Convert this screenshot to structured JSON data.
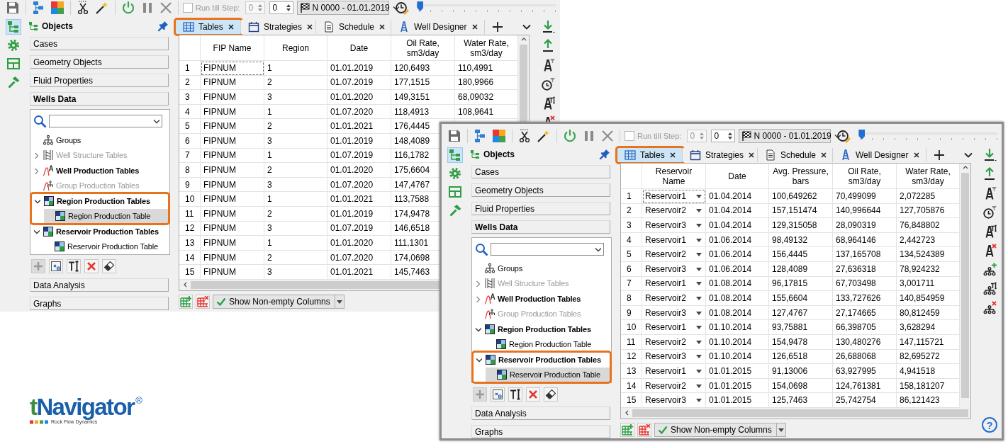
{
  "windows": [
    {
      "framed": false,
      "toolbar": {
        "run_till_step": {
          "label": "Run till Step:",
          "checked": false,
          "value": "0"
        },
        "step": "0",
        "time_step": "N 0000 - 01.01.2019",
        "slider": {
          "level": 0
        }
      },
      "side_tabs": [
        {
          "selected": true
        },
        {
          "selected": false
        },
        {
          "selected": false
        },
        {
          "selected": false
        }
      ],
      "objects_panel": {
        "title": "Objects",
        "sections": [
          {
            "label": "Cases",
            "expanded": false
          },
          {
            "label": "Geometry Objects",
            "expanded": false
          },
          {
            "label": "Fluid Properties",
            "expanded": false
          },
          {
            "label": "Wells Data",
            "expanded": true
          },
          {
            "label": "Data Analysis",
            "expanded": false
          },
          {
            "label": "Graphs",
            "expanded": false
          }
        ],
        "tree": [
          {
            "label": "Groups",
            "kind": "groups",
            "disabled": false,
            "selected": false,
            "highlighted": false
          },
          {
            "label": "Well Structure Tables",
            "kind": "well-structure",
            "expanded": false,
            "disabled": true,
            "selected": false,
            "highlighted": false
          },
          {
            "label": "Well Production Tables",
            "kind": "well-production",
            "expanded": false,
            "disabled": false,
            "selected": false,
            "highlighted": false
          },
          {
            "label": "Group Production Tables",
            "kind": "group-production",
            "disabled": true,
            "selected": false,
            "highlighted": false
          },
          {
            "label": "Region Production Tables",
            "kind": "table",
            "expanded": true,
            "disabled": false,
            "selected": false,
            "highlighted": true,
            "children": [
              {
                "label": "Region Production Table",
                "kind": "table",
                "disabled": false,
                "selected": true,
                "highlighted": false
              }
            ]
          },
          {
            "label": "Reservoir Production Tables",
            "kind": "table",
            "expanded": true,
            "disabled": false,
            "selected": false,
            "highlighted": false,
            "children": [
              {
                "label": "Reservoir Production Table",
                "kind": "table",
                "disabled": false,
                "selected": false,
                "highlighted": false
              }
            ]
          }
        ],
        "tree_tools": [
          {
            "kind": "add",
            "disabled": true
          },
          {
            "kind": "duplicate",
            "disabled": false
          },
          {
            "kind": "rename",
            "disabled": false
          },
          {
            "kind": "delete",
            "disabled": false
          },
          {
            "kind": "clear",
            "disabled": false
          }
        ]
      },
      "tabs": [
        {
          "label": "Tables",
          "kind": "table",
          "selected": true,
          "highlighted": true
        },
        {
          "label": "Strategies",
          "kind": "calendar",
          "selected": false,
          "highlighted": false
        },
        {
          "label": "Schedule",
          "kind": "document",
          "selected": false,
          "highlighted": false
        },
        {
          "label": "Well Designer",
          "kind": "well",
          "selected": false,
          "highlighted": false
        }
      ],
      "table": {
        "columns": [
          {
            "label": "FIP Name",
            "kind": "text"
          },
          {
            "label": "Region",
            "kind": "text"
          },
          {
            "label": "Date",
            "kind": "text"
          },
          {
            "label": "Oil Rate, sm3/day",
            "kind": "text"
          },
          {
            "label": "Water Rate, sm3/day",
            "kind": "text"
          }
        ],
        "rows": [
          {
            "number": "1",
            "focused": true,
            "cells": [
              "FIPNUM",
              "1",
              "01.01.2019",
              "120,6493",
              "110,4991"
            ]
          },
          {
            "number": "2",
            "focused": false,
            "cells": [
              "FIPNUM",
              "2",
              "01.07.2019",
              "177,1515",
              "180,9966"
            ]
          },
          {
            "number": "3",
            "focused": false,
            "cells": [
              "FIPNUM",
              "3",
              "01.01.2020",
              "149,3151",
              "68,09032"
            ]
          },
          {
            "number": "4",
            "focused": false,
            "cells": [
              "FIPNUM",
              "1",
              "01.07.2020",
              "118,4913",
              "108,9641"
            ]
          },
          {
            "number": "5",
            "focused": false,
            "cells": [
              "FIPNUM",
              "2",
              "01.01.2021",
              "176,4445"
            ]
          },
          {
            "number": "6",
            "focused": false,
            "cells": [
              "FIPNUM",
              "3",
              "01.01.2019",
              "148,4089"
            ]
          },
          {
            "number": "7",
            "focused": false,
            "cells": [
              "FIPNUM",
              "1",
              "01.07.2019",
              "116,1782"
            ]
          },
          {
            "number": "8",
            "focused": false,
            "cells": [
              "FIPNUM",
              "2",
              "01.01.2020",
              "175,6604"
            ]
          },
          {
            "number": "9",
            "focused": false,
            "cells": [
              "FIPNUM",
              "3",
              "01.07.2020",
              "147,4767"
            ]
          },
          {
            "number": "10",
            "focused": false,
            "cells": [
              "FIPNUM",
              "1",
              "01.01.2021",
              "113,7588"
            ]
          },
          {
            "number": "11",
            "focused": false,
            "cells": [
              "FIPNUM",
              "2",
              "01.01.2019",
              "174,9478"
            ]
          },
          {
            "number": "12",
            "focused": false,
            "cells": [
              "FIPNUM",
              "3",
              "01.07.2019",
              "146,6518"
            ]
          },
          {
            "number": "13",
            "focused": false,
            "cells": [
              "FIPNUM",
              "1",
              "01.01.2020",
              "111,1301"
            ]
          },
          {
            "number": "14",
            "focused": false,
            "cells": [
              "FIPNUM",
              "2",
              "01.07.2020",
              "174,0698"
            ]
          },
          {
            "number": "15",
            "focused": false,
            "cells": [
              "FIPNUM",
              "3",
              "01.01.2021",
              "145,7463"
            ]
          }
        ]
      },
      "show_columns_button": "Show Non-empty Columns",
      "right_toolbar": [
        {
          "kind": "import"
        },
        {
          "kind": "export"
        },
        {
          "kind": "well-filter"
        },
        {
          "kind": "clock-filter"
        },
        {
          "kind": "well-text"
        },
        {
          "kind": "well-delete"
        }
      ]
    },
    {
      "framed": true,
      "toolbar": {
        "run_till_step": {
          "label": "Run till Step:",
          "checked": false,
          "value": "0"
        },
        "step": "0",
        "time_step": "N 0000 - 01.01.2019",
        "slider": {
          "level": 0
        }
      },
      "side_tabs": [
        {
          "selected": true
        },
        {
          "selected": false
        },
        {
          "selected": false
        },
        {
          "selected": false
        }
      ],
      "objects_panel": {
        "title": "Objects",
        "sections": [
          {
            "label": "Cases",
            "expanded": false
          },
          {
            "label": "Geometry Objects",
            "expanded": false
          },
          {
            "label": "Fluid Properties",
            "expanded": false
          },
          {
            "label": "Wells Data",
            "expanded": true
          },
          {
            "label": "Data Analysis",
            "expanded": false
          },
          {
            "label": "Graphs",
            "expanded": false
          }
        ],
        "tree": [
          {
            "label": "Groups",
            "kind": "groups",
            "disabled": false,
            "selected": false,
            "highlighted": false
          },
          {
            "label": "Well Structure Tables",
            "kind": "well-structure",
            "expanded": false,
            "disabled": true,
            "selected": false,
            "highlighted": false
          },
          {
            "label": "Well Production Tables",
            "kind": "well-production",
            "expanded": false,
            "disabled": false,
            "selected": false,
            "highlighted": false
          },
          {
            "label": "Group Production Tables",
            "kind": "group-production",
            "disabled": true,
            "selected": false,
            "highlighted": false
          },
          {
            "label": "Region Production Tables",
            "kind": "table",
            "expanded": true,
            "disabled": false,
            "selected": false,
            "highlighted": false,
            "children": [
              {
                "label": "Region Production Table",
                "kind": "table",
                "disabled": false,
                "selected": false,
                "highlighted": false
              }
            ]
          },
          {
            "label": "Reservoir Production Tables",
            "kind": "table",
            "expanded": true,
            "disabled": false,
            "selected": false,
            "highlighted": true,
            "children": [
              {
                "label": "Reservoir Production Table",
                "kind": "table",
                "disabled": false,
                "selected": true,
                "highlighted": false
              }
            ]
          }
        ],
        "tree_tools": [
          {
            "kind": "add",
            "disabled": true
          },
          {
            "kind": "duplicate",
            "disabled": false
          },
          {
            "kind": "rename",
            "disabled": false
          },
          {
            "kind": "delete",
            "disabled": false
          },
          {
            "kind": "clear",
            "disabled": false
          }
        ]
      },
      "tabs": [
        {
          "label": "Tables",
          "kind": "table",
          "selected": true,
          "highlighted": true
        },
        {
          "label": "Strategies",
          "kind": "calendar",
          "selected": false,
          "highlighted": false
        },
        {
          "label": "Schedule",
          "kind": "document",
          "selected": false,
          "highlighted": false
        },
        {
          "label": "Well Designer",
          "kind": "well",
          "selected": false,
          "highlighted": false
        }
      ],
      "table": {
        "columns": [
          {
            "label": "Reservoir Name",
            "kind": "dropdown"
          },
          {
            "label": "Date",
            "kind": "text"
          },
          {
            "label": "Avg. Pressure, bars",
            "kind": "text"
          },
          {
            "label": "Oil Rate, sm3/day",
            "kind": "text"
          },
          {
            "label": "Water Rate, sm3/day",
            "kind": "text"
          }
        ],
        "rows": [
          {
            "number": "1",
            "focused": true,
            "cells": [
              "Reservoir1",
              "01.04.2014",
              "100,649262",
              "70,499099",
              "2,072285"
            ]
          },
          {
            "number": "2",
            "focused": false,
            "cells": [
              "Reservoir2",
              "01.04.2014",
              "157,151474",
              "140,996644",
              "127,705876"
            ]
          },
          {
            "number": "3",
            "focused": false,
            "cells": [
              "Reservoir3",
              "01.04.2014",
              "129,315058",
              "28,090319",
              "76,848802"
            ]
          },
          {
            "number": "4",
            "focused": false,
            "cells": [
              "Reservoir1",
              "01.06.2014",
              "98,49132",
              "68,964146",
              "2,442723"
            ]
          },
          {
            "number": "5",
            "focused": false,
            "cells": [
              "Reservoir2",
              "01.06.2014",
              "156,4445",
              "137,165708",
              "134,524389"
            ]
          },
          {
            "number": "6",
            "focused": false,
            "cells": [
              "Reservoir3",
              "01.06.2014",
              "128,4089",
              "27,636318",
              "78,924232"
            ]
          },
          {
            "number": "7",
            "focused": false,
            "cells": [
              "Reservoir1",
              "01.08.2014",
              "96,17815",
              "67,703498",
              "3,001711"
            ]
          },
          {
            "number": "8",
            "focused": false,
            "cells": [
              "Reservoir2",
              "01.08.2014",
              "155,6604",
              "133,727626",
              "140,854959"
            ]
          },
          {
            "number": "9",
            "focused": false,
            "cells": [
              "Reservoir3",
              "01.08.2014",
              "127,4767",
              "27,174665",
              "80,812459"
            ]
          },
          {
            "number": "10",
            "focused": false,
            "cells": [
              "Reservoir1",
              "01.10.2014",
              "93,75881",
              "66,398705",
              "3,628294"
            ]
          },
          {
            "number": "11",
            "focused": false,
            "cells": [
              "Reservoir2",
              "01.10.2014",
              "154,9478",
              "130,480276",
              "147,115721"
            ]
          },
          {
            "number": "12",
            "focused": false,
            "cells": [
              "Reservoir3",
              "01.10.2014",
              "126,6518",
              "26,688068",
              "82,695272"
            ]
          },
          {
            "number": "13",
            "focused": false,
            "cells": [
              "Reservoir1",
              "01.01.2015",
              "91,13006",
              "63,927995",
              "4,941518"
            ]
          },
          {
            "number": "14",
            "focused": false,
            "cells": [
              "Reservoir2",
              "01.01.2015",
              "154,0698",
              "124,761381",
              "158,181207"
            ]
          },
          {
            "number": "15",
            "focused": false,
            "cells": [
              "Reservoir3",
              "01.01.2015",
              "125,7463",
              "25,742754",
              "86,121423"
            ]
          }
        ]
      },
      "show_columns_button": "Show Non-empty Columns",
      "right_toolbar": [
        {
          "kind": "import"
        },
        {
          "kind": "export"
        },
        {
          "kind": "well-filter"
        },
        {
          "kind": "clock-filter"
        },
        {
          "kind": "well-text"
        },
        {
          "kind": "well-delete"
        },
        {
          "kind": "tree-add"
        },
        {
          "kind": "tree-text"
        },
        {
          "kind": "tree-delete"
        }
      ],
      "help_button": "?"
    }
  ],
  "logo": {
    "name": "tNavigator",
    "mark": "®",
    "tagline": "Rock Flow Dynamics"
  }
}
